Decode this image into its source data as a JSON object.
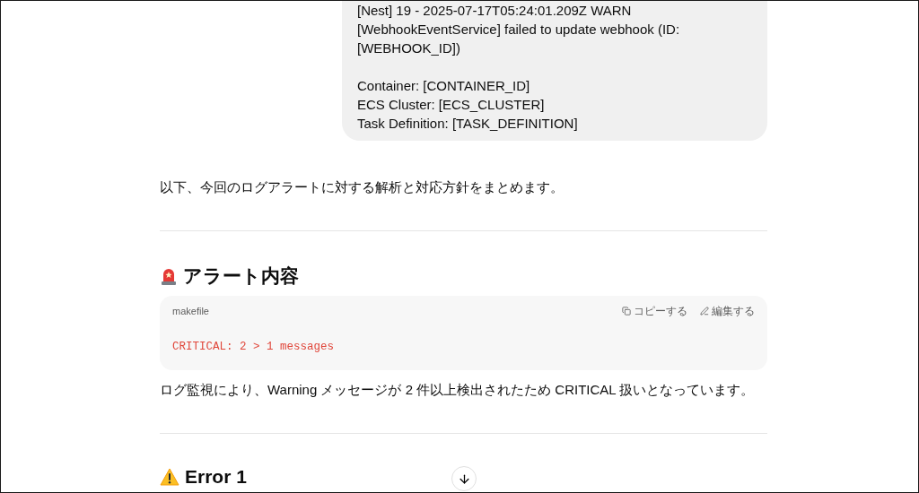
{
  "user_message": {
    "paragraphs": [
      [
        "[Nest] 19 - 2025-07-17T05:24:01.209Z WARN",
        "[WebhookEventService] failed to update webhook (ID:",
        "[WEBHOOK_ID])"
      ],
      [
        "Container: [CONTAINER_ID]",
        "ECS Cluster: [ECS_CLUSTER]",
        "Task Definition: [TASK_DEFINITION]"
      ]
    ]
  },
  "response": [
    {
      "kind": "paragraph",
      "text": "以下、今回のログアラートに対する解析と対応方針をまとめます。"
    },
    {
      "kind": "divider"
    },
    {
      "kind": "heading",
      "text": "アラート内容"
    },
    {
      "kind": "code",
      "language": "makefile",
      "copy_label": "コピーする",
      "edit_label": "編集する",
      "code": "CRITICAL: 2 > 1 messages"
    },
    {
      "kind": "paragraph",
      "text": "ログ監視により、Warning メッセージが 2 件以上検出されたため CRITICAL 扱いとなっています。"
    },
    {
      "kind": "divider"
    },
    {
      "kind": "heading",
      "text": "Error 1"
    }
  ]
}
